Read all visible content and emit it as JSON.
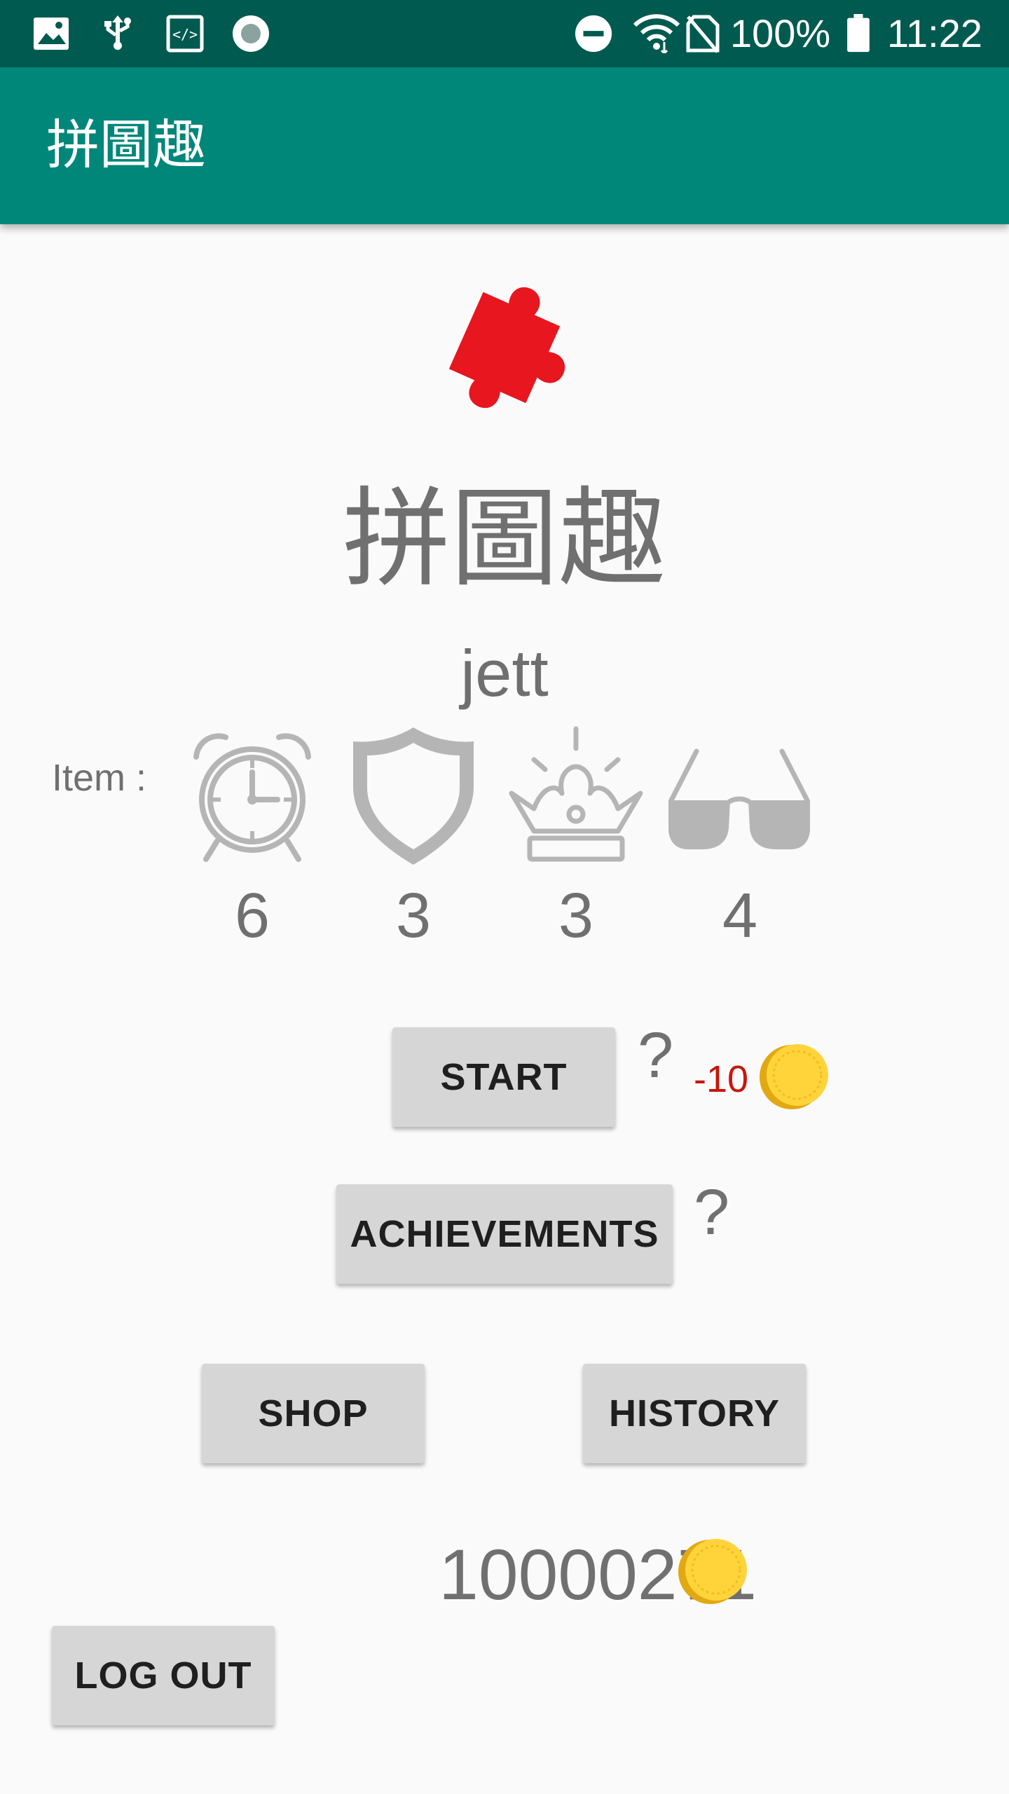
{
  "status_bar": {
    "battery": "100%",
    "time": "11:22",
    "icons": [
      "image-icon",
      "usb-icon",
      "code-icon",
      "record-icon",
      "dnd-icon",
      "wifi-icon",
      "no-sim-icon",
      "battery-icon"
    ]
  },
  "app_bar": {
    "title": "拼圖趣"
  },
  "header": {
    "title": "拼圖趣",
    "username": "jett"
  },
  "items": {
    "label": "Item :",
    "list": [
      {
        "icon": "alarm-clock-icon",
        "count": "6"
      },
      {
        "icon": "shield-icon",
        "count": "3"
      },
      {
        "icon": "crown-icon",
        "count": "3"
      },
      {
        "icon": "sunglasses-icon",
        "count": "4"
      }
    ]
  },
  "buttons": {
    "start": "START",
    "achievements": "ACHIEVEMENTS",
    "shop": "SHOP",
    "history": "HISTORY",
    "logout": "LOG OUT"
  },
  "help": {
    "start": "?",
    "achievements": "?"
  },
  "start_cost": "-10",
  "coins": "10000271",
  "colors": {
    "status_bar": "#015a4f",
    "app_bar": "#00877a",
    "puzzle": "#e8161e",
    "coin": "#ffd43b",
    "cost": "#c8160c",
    "button": "#d6d6d6",
    "item_icon": "#b5b5b5"
  }
}
